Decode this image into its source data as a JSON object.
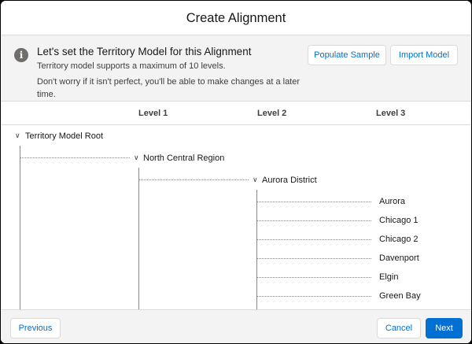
{
  "modal": {
    "title": "Create Alignment"
  },
  "banner": {
    "icon": "info-icon",
    "heading": "Let's set the Territory Model for this Alignment",
    "line1": "Territory model supports a maximum of 10 levels.",
    "line2": "Don't worry if it isn't perfect, you'll be able to make changes at a later time.",
    "populate_label": "Populate Sample",
    "import_label": "Import Model"
  },
  "levels": [
    "Level 1",
    "Level 2",
    "Level 3"
  ],
  "tree": {
    "root": "Territory Model Root",
    "region": "North Central Region",
    "district": "Aurora District",
    "territories": [
      "Aurora",
      "Chicago 1",
      "Chicago 2",
      "Davenport",
      "Elgin",
      "Green Bay"
    ]
  },
  "footer": {
    "previous_label": "Previous",
    "cancel_label": "Cancel",
    "next_label": "Next"
  }
}
